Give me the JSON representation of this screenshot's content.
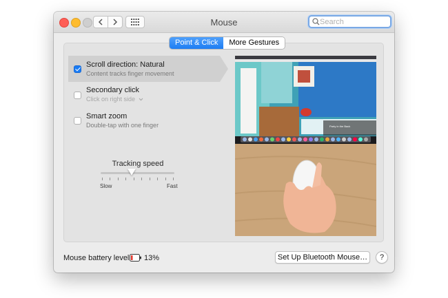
{
  "window": {
    "title": "Mouse"
  },
  "toolbar": {
    "back_icon": "chevron-left-icon",
    "forward_icon": "chevron-right-icon",
    "grid_icon": "grid-icon"
  },
  "search": {
    "placeholder": "Search",
    "value": ""
  },
  "tabs": [
    {
      "label": "Point & Click",
      "active": true
    },
    {
      "label": "More Gestures",
      "active": false
    }
  ],
  "options": [
    {
      "title": "Scroll direction: Natural",
      "subtitle": "Content tracks finger movement",
      "checked": true,
      "selected": true
    },
    {
      "title": "Secondary click",
      "subtitle": "Click on right side",
      "checked": false,
      "has_dropdown": true
    },
    {
      "title": "Smart zoom",
      "subtitle": "Double-tap with one finger",
      "checked": false
    }
  ],
  "tracking": {
    "label": "Tracking speed",
    "min_label": "Slow",
    "max_label": "Fast",
    "ticks": 10,
    "value_fraction": 0.42
  },
  "preview": {
    "caption": "Party in the Back"
  },
  "battery": {
    "label": "Mouse battery level:",
    "percent": "13%"
  },
  "buttons": {
    "bluetooth": "Set Up Bluetooth Mouse…",
    "help": "?"
  },
  "colors": {
    "accent": "#1a7cf4",
    "battery_low": "#e0352b"
  }
}
